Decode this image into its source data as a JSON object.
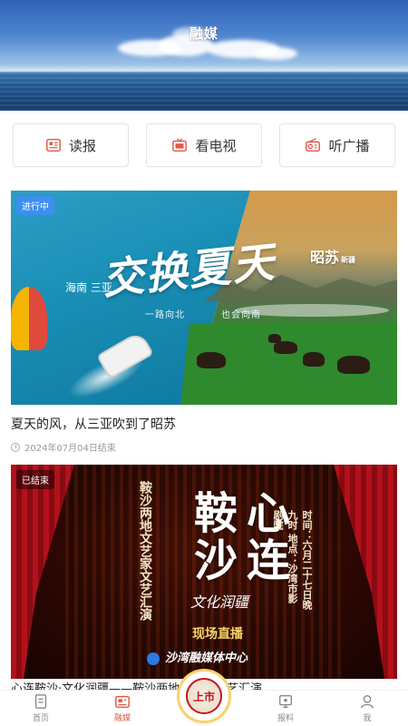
{
  "hero": {
    "title": "融媒"
  },
  "media_buttons": [
    {
      "label": "读报",
      "icon": "newspaper-icon"
    },
    {
      "label": "看电视",
      "icon": "tv-icon"
    },
    {
      "label": "听广播",
      "icon": "radio-icon"
    }
  ],
  "events": [
    {
      "status": "进行中",
      "title": "夏天的风，从三亚吹到了昭苏",
      "date": "2024年07月04日结束",
      "poster": {
        "headline": "交换夏天",
        "left_place": "海南 三亚",
        "right_place": "昭苏",
        "right_place_tag": "新疆",
        "left_tagline": "一路向北",
        "right_tagline": "也会向南"
      }
    },
    {
      "status": "已结束",
      "title": "心连鞍沙·文化润疆——鞍沙两地文艺家文艺汇演",
      "poster": {
        "left_column": "鞍沙两地文艺家文艺汇演",
        "headline_line1": "心连",
        "headline_line2": "鞍沙",
        "subtitle": "文化润疆",
        "info_column": "时间：六月二十七日晚九时 地点：沙湾市影剧院",
        "live_label": "现场直播",
        "organizer": "沙湾融媒体中心"
      }
    }
  ],
  "tabbar": {
    "items": [
      {
        "label": "首页",
        "icon": "home-icon",
        "active": false
      },
      {
        "label": "融媒",
        "icon": "media-icon",
        "active": true
      },
      {
        "label": "报料",
        "icon": "report-icon",
        "active": false
      },
      {
        "label": "我",
        "icon": "user-icon",
        "active": false
      }
    ],
    "center_button_text": "上市"
  },
  "colors": {
    "accent": "#e0594a",
    "badge_active": "#3d8ff0"
  }
}
